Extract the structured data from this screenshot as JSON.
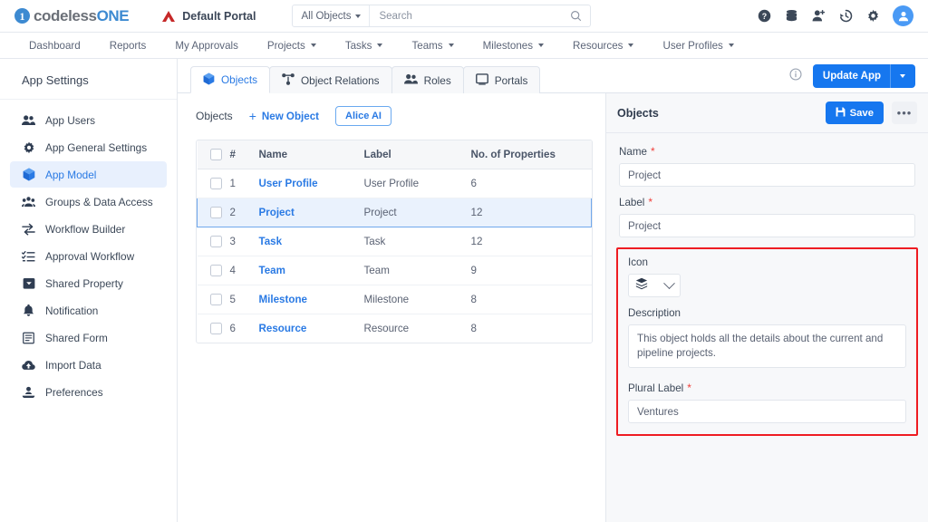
{
  "topbar": {
    "logo_mark": "1",
    "logo_text_a": "codeless",
    "logo_text_b": "ONE",
    "portal_name": "Default Portal",
    "portal_icon": "triangle-brand-icon",
    "search": {
      "scope": "All Objects",
      "placeholder": "Search",
      "value": ""
    },
    "icons": [
      {
        "name": "help-icon",
        "glyph": "?"
      },
      {
        "name": "database-icon",
        "glyph": ""
      },
      {
        "name": "add-user-icon",
        "glyph": ""
      },
      {
        "name": "history-icon",
        "glyph": ""
      },
      {
        "name": "settings-gear-icon",
        "glyph": ""
      },
      {
        "name": "user-avatar",
        "glyph": ""
      }
    ]
  },
  "nav": {
    "items": [
      {
        "label": "Dashboard",
        "has_caret": false
      },
      {
        "label": "Reports",
        "has_caret": false
      },
      {
        "label": "My Approvals",
        "has_caret": false
      },
      {
        "label": "Projects",
        "has_caret": true
      },
      {
        "label": "Tasks",
        "has_caret": true
      },
      {
        "label": "Teams",
        "has_caret": true
      },
      {
        "label": "Milestones",
        "has_caret": true
      },
      {
        "label": "Resources",
        "has_caret": true
      },
      {
        "label": "User Profiles",
        "has_caret": true
      }
    ]
  },
  "sidebar": {
    "title": "App Settings",
    "items": [
      {
        "label": "App Users",
        "icon": "users-icon",
        "active": false
      },
      {
        "label": "App General Settings",
        "icon": "gear-icon",
        "active": false
      },
      {
        "label": "App Model",
        "icon": "cube-icon",
        "active": true
      },
      {
        "label": "Groups & Data Access",
        "icon": "group-users-icon",
        "active": false
      },
      {
        "label": "Workflow Builder",
        "icon": "arrows-exchange-icon",
        "active": false
      },
      {
        "label": "Approval Workflow",
        "icon": "checklist-icon",
        "active": false
      },
      {
        "label": "Shared Property",
        "icon": "tag-box-icon",
        "active": false
      },
      {
        "label": "Notification",
        "icon": "bell-icon",
        "active": false
      },
      {
        "label": "Shared Form",
        "icon": "form-icon",
        "active": false
      },
      {
        "label": "Import Data",
        "icon": "cloud-upload-icon",
        "active": false
      },
      {
        "label": "Preferences",
        "icon": "preferences-icon",
        "active": false
      }
    ]
  },
  "main": {
    "tabs": [
      {
        "label": "Objects",
        "icon": "cube-icon",
        "active": true
      },
      {
        "label": "Object Relations",
        "icon": "relations-icon",
        "active": false
      },
      {
        "label": "Roles",
        "icon": "roles-users-icon",
        "active": false
      },
      {
        "label": "Portals",
        "icon": "portal-screen-icon",
        "active": false
      }
    ],
    "info_icon": "info-circle-icon",
    "update_button": {
      "label": "Update App",
      "caret": "chevron-down-icon",
      "color": "#1677ef"
    },
    "toolbar": {
      "breadcrumb": "Objects",
      "new_object_label": "New Object",
      "new_object_plus": "+",
      "alice_ai_label": "Alice AI"
    },
    "table": {
      "columns": [
        "#",
        "Name",
        "Label",
        "No. of Properties"
      ],
      "rows": [
        {
          "num": "1",
          "name": "User Profile",
          "label": "User Profile",
          "props": "6",
          "selected": false
        },
        {
          "num": "2",
          "name": "Project",
          "label": "Project",
          "props": "12",
          "selected": true
        },
        {
          "num": "3",
          "name": "Task",
          "label": "Task",
          "props": "12",
          "selected": false
        },
        {
          "num": "4",
          "name": "Team",
          "label": "Team",
          "props": "9",
          "selected": false
        },
        {
          "num": "5",
          "name": "Milestone",
          "label": "Milestone",
          "props": "8",
          "selected": false
        },
        {
          "num": "6",
          "name": "Resource",
          "label": "Resource",
          "props": "8",
          "selected": false
        }
      ]
    }
  },
  "detail_panel": {
    "title": "Objects",
    "save_label": "Save",
    "save_icon": "save-disk-icon",
    "more_label": "•••",
    "fields": {
      "name": {
        "label": "Name",
        "required": "*",
        "value": "Project"
      },
      "label": {
        "label": "Label",
        "required": "*",
        "value": "Project"
      },
      "icon": {
        "label": "Icon",
        "required": "",
        "selected_icon": "layers-stack-icon",
        "caret": "chevron-down-icon"
      },
      "description": {
        "label": "Description",
        "required": "",
        "value": "This object holds all the details about the current and pipeline projects."
      },
      "plural_label": {
        "label": "Plural Label",
        "required": "*",
        "value": "Ventures"
      }
    },
    "highlight_color": "#ee1c22"
  }
}
